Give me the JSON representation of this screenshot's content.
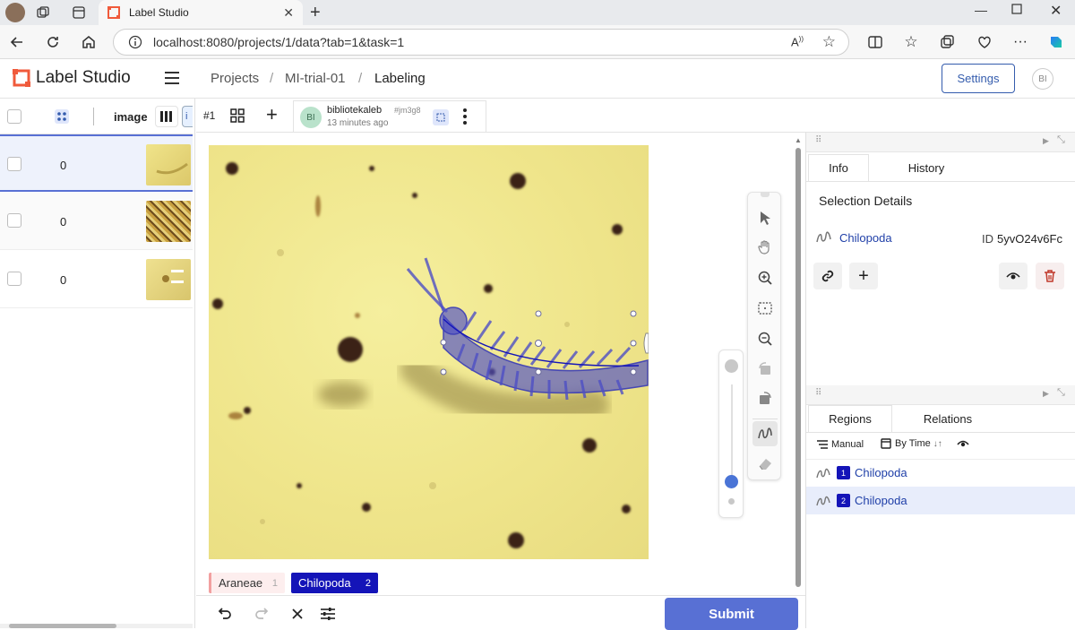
{
  "browser": {
    "tab_title": "Label Studio",
    "url": "localhost:8080/projects/1/data?tab=1&task=1"
  },
  "app": {
    "brand": "Label Studio",
    "breadcrumb": [
      "Projects",
      "/",
      "MI-trial-01",
      "/",
      "Labeling"
    ],
    "settings_label": "Settings",
    "user_initials": "BI"
  },
  "task_list": {
    "column_header": "image",
    "rows": [
      {
        "count": "0"
      },
      {
        "count": "0"
      },
      {
        "count": "0"
      }
    ]
  },
  "annotation": {
    "tab_id": "#1",
    "author": "bibliotekaleb",
    "author_initials": "BI",
    "annotation_hash": "#jm3g8",
    "time_ago": "13 minutes ago"
  },
  "labels": [
    {
      "name": "Araneae",
      "hotkey": "1",
      "color": "#f2a0a0",
      "selected": false
    },
    {
      "name": "Chilopoda",
      "hotkey": "2",
      "color": "#1414b8",
      "selected": true
    }
  ],
  "bottom": {
    "submit_label": "Submit"
  },
  "info_panel": {
    "tabs": [
      "Info",
      "History"
    ],
    "active_tab": "Info",
    "section_title": "Selection Details",
    "selected_label": "Chilopoda",
    "id_prefix": "ID",
    "selected_id": "5yvO24v6Fc"
  },
  "regions_panel": {
    "tabs": [
      "Regions",
      "Relations"
    ],
    "active_tab": "Regions",
    "sort_manual": "Manual",
    "sort_by_time": "By Time",
    "items": [
      {
        "index": "1",
        "label": "Chilopoda",
        "selected": false
      },
      {
        "index": "2",
        "label": "Chilopoda",
        "selected": true
      }
    ]
  },
  "colors": {
    "accent": "#345cad",
    "submit": "#5870d4",
    "region_blue": "#1414b8",
    "selected_row": "#e8edfb"
  }
}
